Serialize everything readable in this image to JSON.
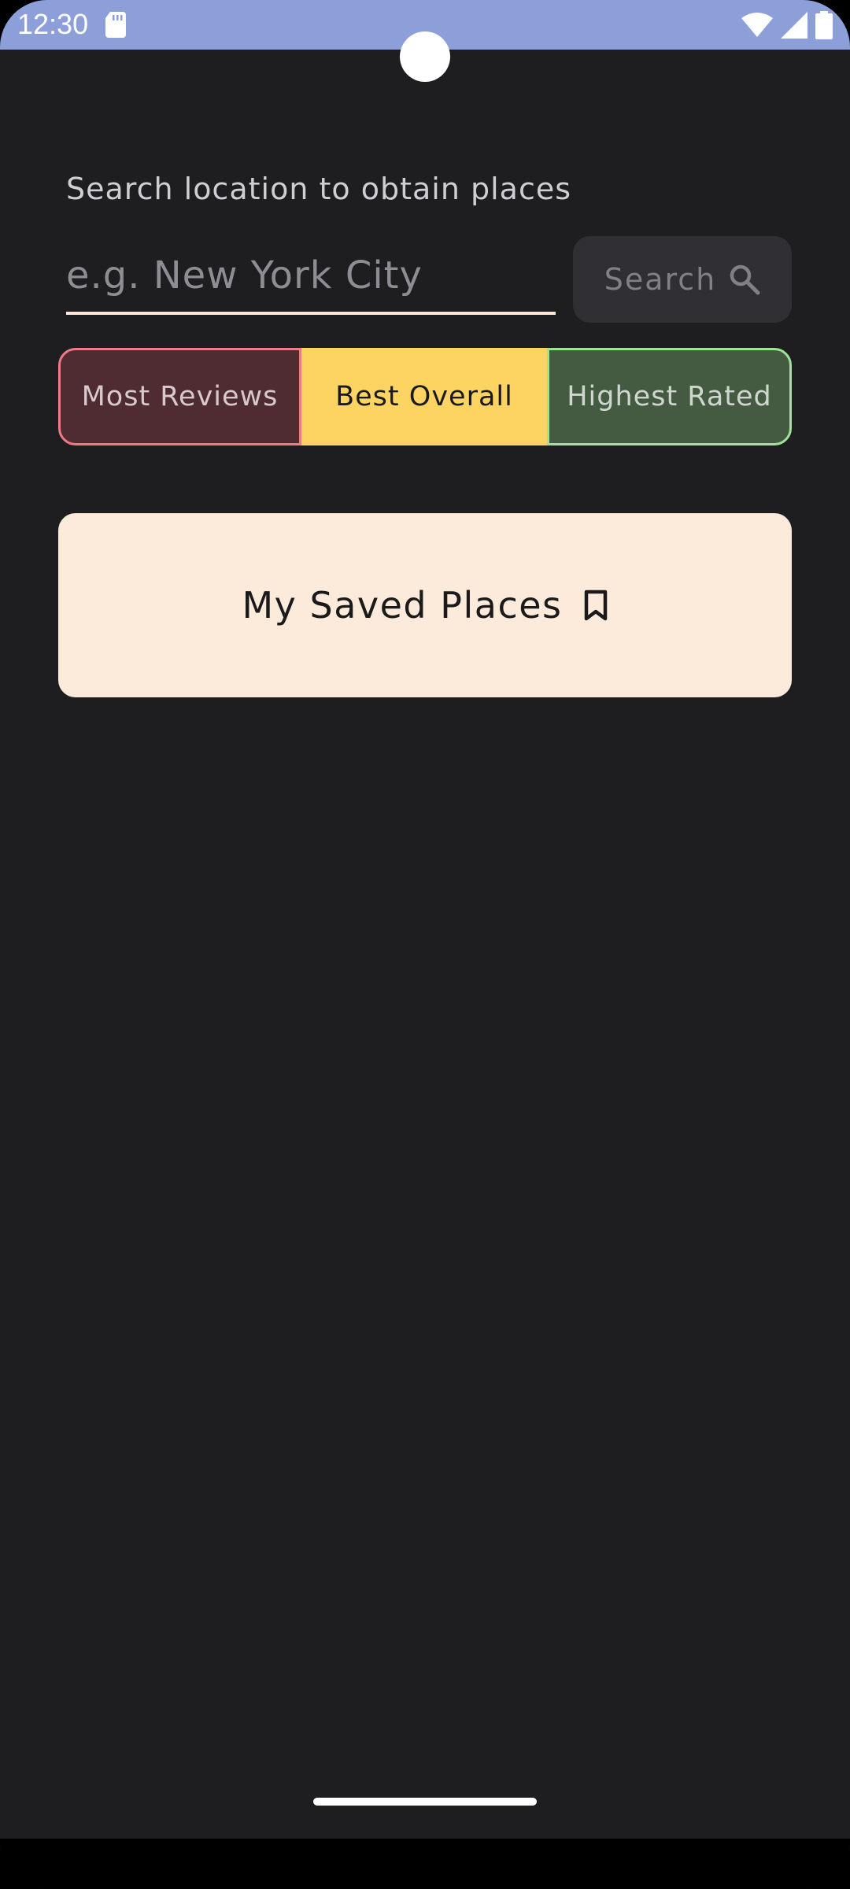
{
  "status_bar": {
    "time": "12:30",
    "bg_color": "#8c9fd8"
  },
  "search": {
    "label": "Search location to obtain places",
    "placeholder": "e.g. New York City",
    "value": "",
    "button_label": "Search",
    "button_icon": "search-icon"
  },
  "filters": {
    "options": [
      "Most Reviews",
      "Best Overall",
      "Highest Rated"
    ],
    "selected": "Best Overall",
    "colors": {
      "most_reviews": "#4f2b32",
      "best_overall": "#fdd462",
      "highest_rated": "#445b41"
    }
  },
  "saved": {
    "label": "My Saved Places",
    "icon": "bookmark-icon",
    "bg_color": "#fceadb"
  },
  "theme": {
    "background": "#1e1e21",
    "accent_underline": "#fbe9d7"
  }
}
